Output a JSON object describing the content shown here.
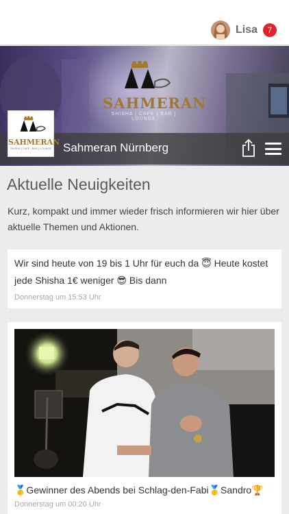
{
  "header": {
    "username": "Lisa",
    "notification_count": "7"
  },
  "hero": {
    "logo_text": "SAHMERAN",
    "logo_subtext": "SHISHA | CAFE | BAR | LOUNGE",
    "venue_name": "Sahmeran Nürnberg"
  },
  "news": {
    "title": "Aktuelle Neuigkeiten",
    "description": "Kurz, kompakt und immer wieder frisch informieren wir hier über aktuelle Themen und Aktionen.",
    "posts": [
      {
        "text": "Wir sind heute von 19 bis 1 Uhr für euch da 😇 Heute kostet jede Shisha 1€ weniger 😎 Bis dann",
        "time": "Donnerstag um 15:53 Uhr"
      },
      {
        "caption": "🥇Gewinner des Abends bei Schlag-den-Fabi🥇Sandro🏆",
        "time": "Donnerstag um 00:20 Uhr"
      }
    ]
  },
  "colors": {
    "badge": "#e0242b",
    "titlebar": "#3c3c3c",
    "accent_gold": "#a07830"
  }
}
